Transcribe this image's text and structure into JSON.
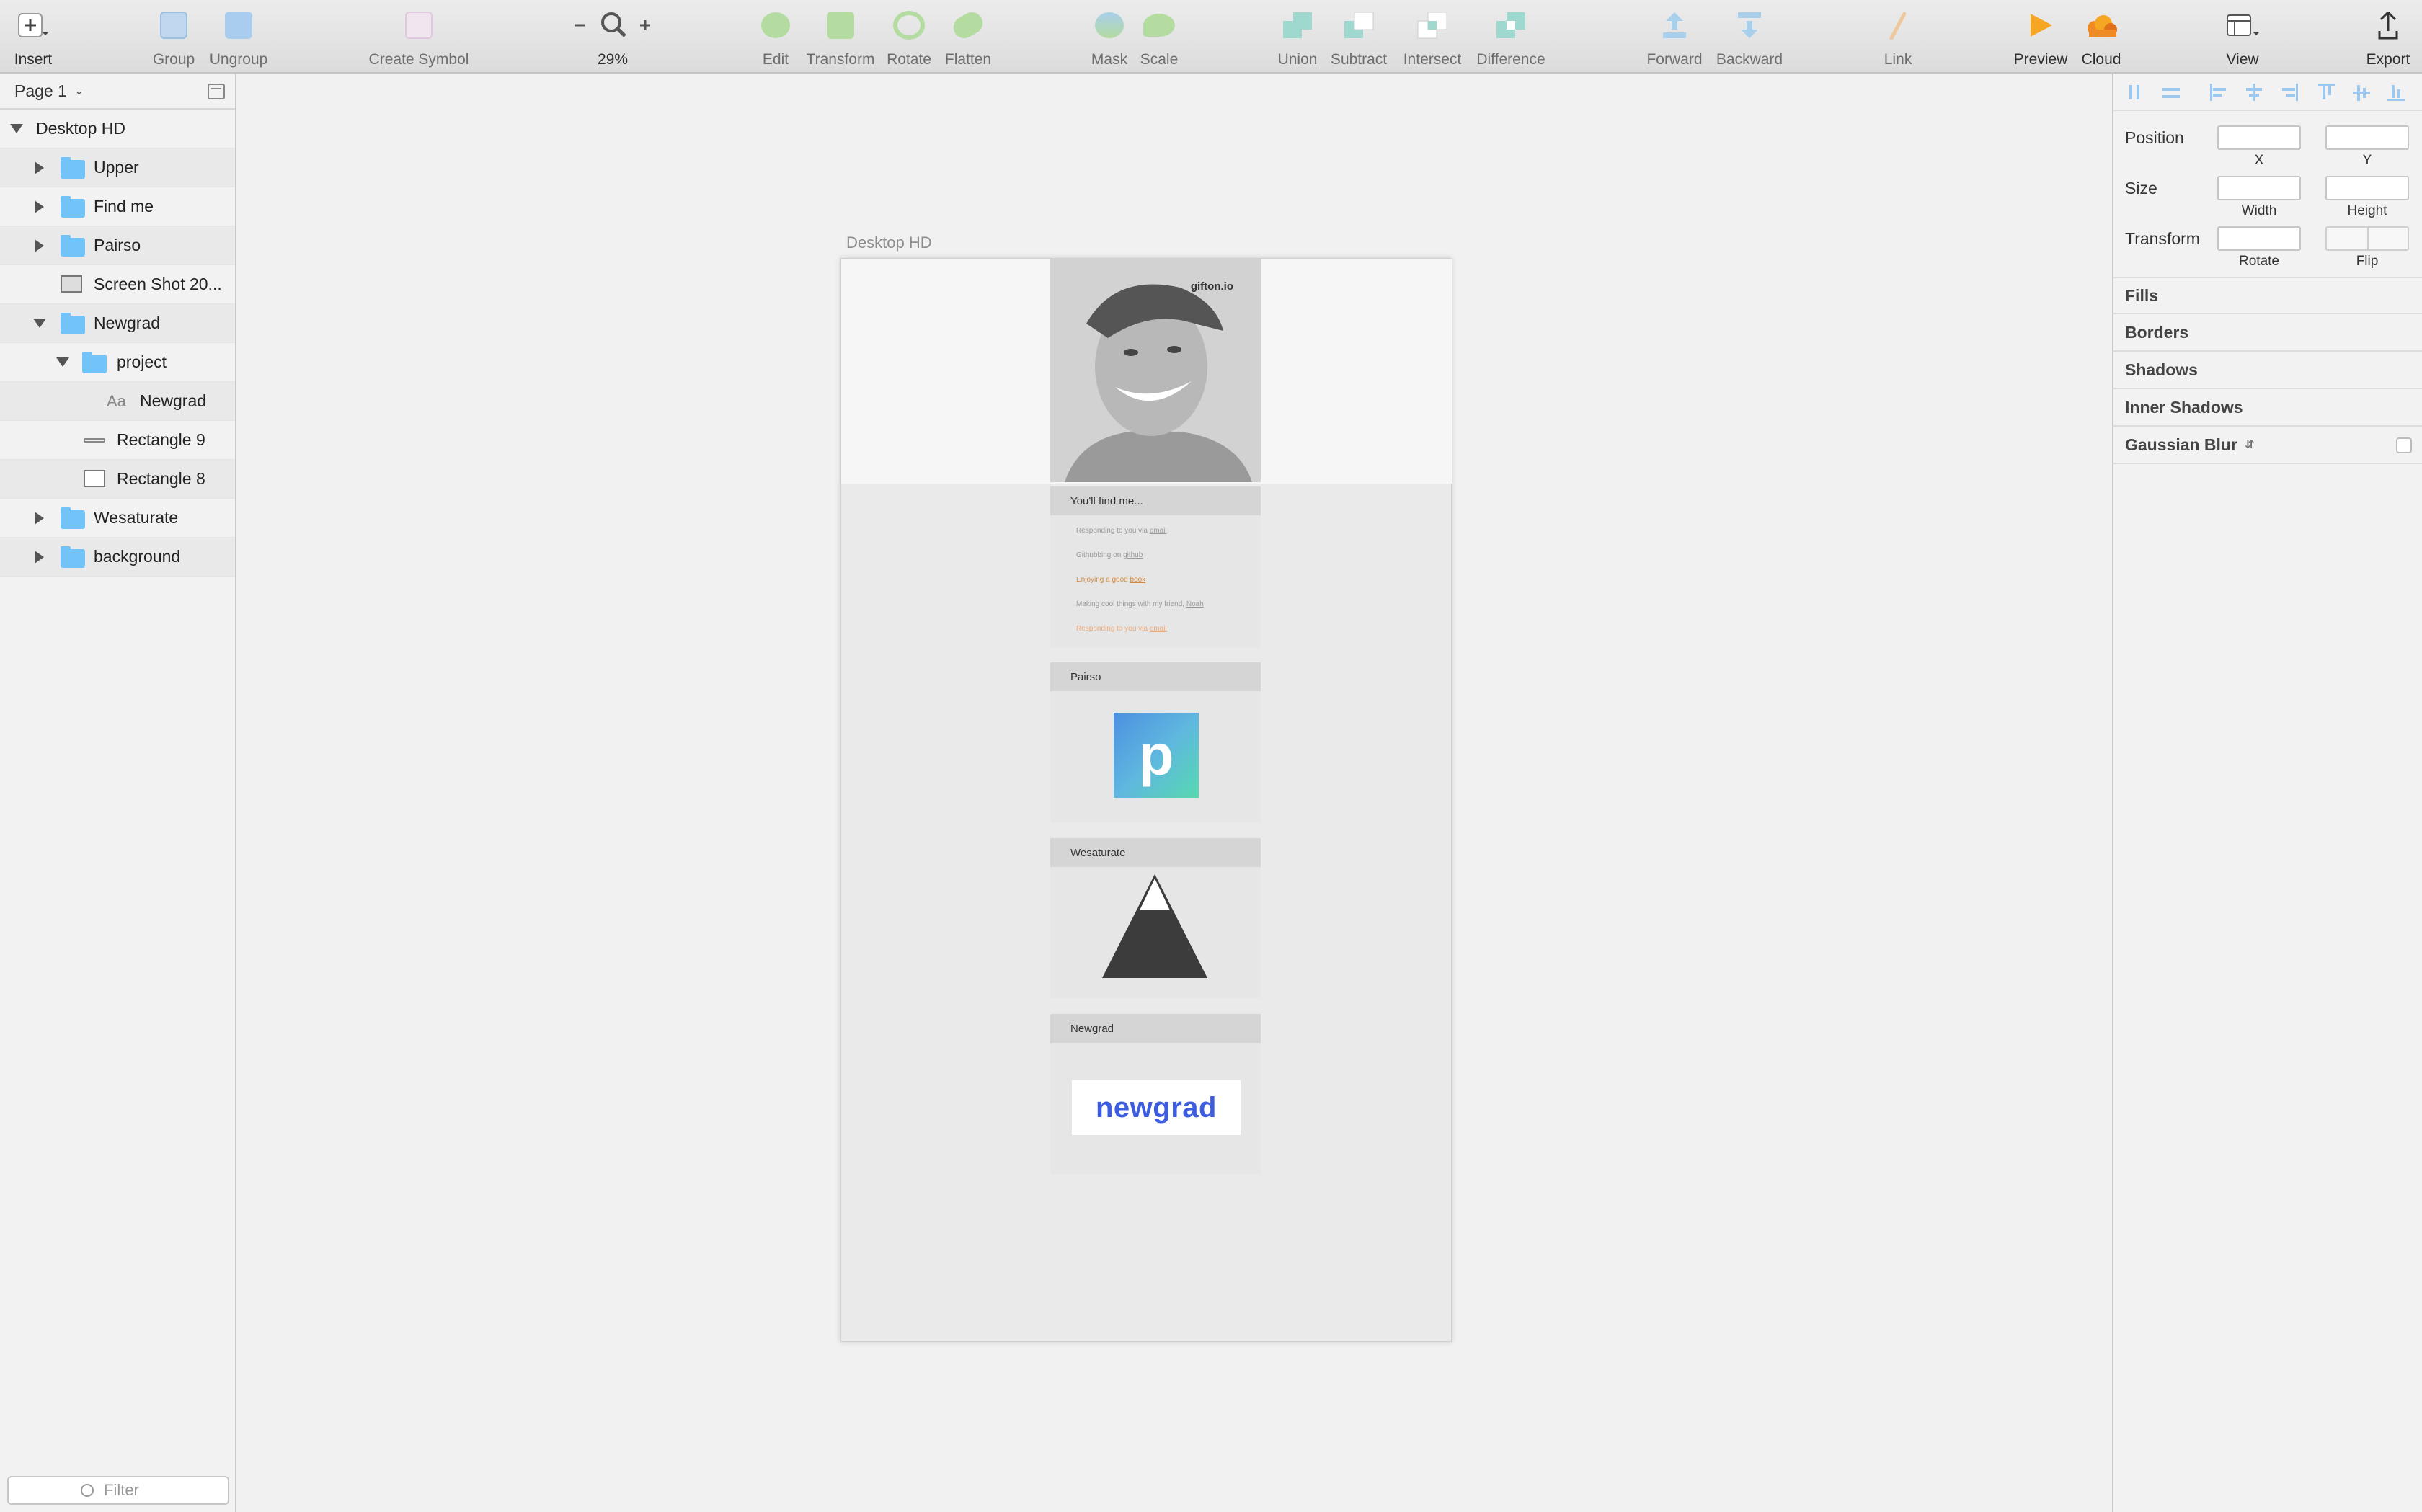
{
  "toolbar": {
    "insert": "Insert",
    "group": "Group",
    "ungroup": "Ungroup",
    "create_symbol": "Create Symbol",
    "zoom": "29%",
    "edit": "Edit",
    "transform": "Transform",
    "rotate": "Rotate",
    "flatten": "Flatten",
    "mask": "Mask",
    "scale": "Scale",
    "union": "Union",
    "subtract": "Subtract",
    "intersect": "Intersect",
    "difference": "Difference",
    "forward": "Forward",
    "backward": "Backward",
    "link": "Link",
    "preview": "Preview",
    "cloud": "Cloud",
    "view": "View",
    "export": "Export"
  },
  "sidebar": {
    "page": "Page 1",
    "layers": [
      "Desktop HD",
      "Upper",
      "Find me",
      "Pairso",
      "Screen Shot 20...",
      "Newgrad",
      "project",
      "Newgrad",
      "Rectangle 9",
      "Rectangle 8",
      "Wesaturate",
      "background"
    ],
    "text_layer_icon": "Aa",
    "filter_placeholder": "Filter"
  },
  "canvas": {
    "artboard_label": "Desktop HD",
    "brand": "gifton.io",
    "findme": {
      "title": "You'll find me...",
      "lines": [
        {
          "prefix": "Responding to you via ",
          "link": "email",
          "color": "#9a9a9a"
        },
        {
          "prefix": "Githubbing on ",
          "link": "github",
          "color": "#9a9a9a"
        },
        {
          "prefix": "Enjoying a good ",
          "link": "book",
          "color": "#d08a48"
        },
        {
          "prefix": "Making cool things with my friend, ",
          "link": "Noah",
          "color": "#9a9a9a"
        },
        {
          "prefix": "Responding to you via ",
          "link": "email",
          "color": "#f0a878"
        }
      ]
    },
    "pairso": {
      "title": "Pairso",
      "logo_letter": "p"
    },
    "wesaturate": {
      "title": "Wesaturate"
    },
    "newgrad": {
      "title": "Newgrad",
      "logo_text": "newgrad"
    }
  },
  "inspector": {
    "position": "Position",
    "x": "X",
    "y": "Y",
    "size": "Size",
    "width": "Width",
    "height": "Height",
    "transform": "Transform",
    "rotate": "Rotate",
    "flip": "Flip",
    "fills": "Fills",
    "borders": "Borders",
    "shadows": "Shadows",
    "inner_shadows": "Inner Shadows",
    "gaussian_blur": "Gaussian Blur"
  },
  "colors": {
    "accent_blue": "#72c3f7",
    "newgrad_blue": "#3c5de0",
    "preview_orange": "#f5a623"
  }
}
